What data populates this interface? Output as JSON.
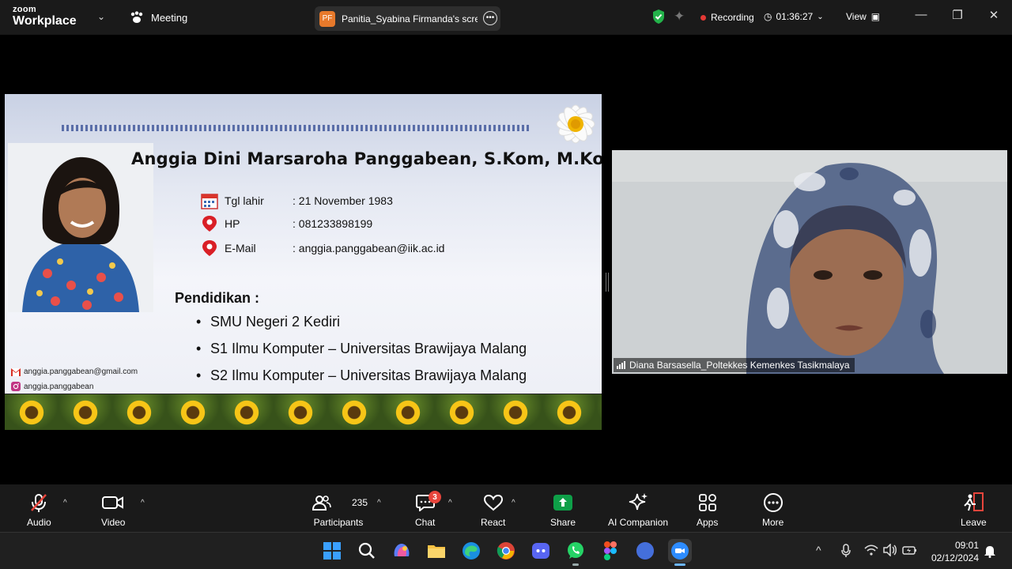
{
  "app": {
    "brand_line1": "zoom",
    "brand_line2": "Workplace",
    "meeting_label": "Meeting"
  },
  "share": {
    "initials": "PF",
    "title": "Panitia_Syabina Firmanda's screen"
  },
  "status": {
    "recording_label": "Recording",
    "timer": "01:36:27",
    "view_label": "View"
  },
  "slide": {
    "name": "Anggia Dini Marsaroha Panggabean, S.Kom, M.Kom.",
    "info": [
      {
        "label": "Tgl lahir",
        "value": ": 21 November 1983"
      },
      {
        "label": "HP",
        "value": ": 081233898199"
      },
      {
        "label": "E-Mail",
        "value": ": anggia.panggabean@iik.ac.id"
      }
    ],
    "education_title": "Pendidikan :",
    "education": [
      "SMU Negeri 2 Kediri",
      "S1 Ilmu Komputer – Universitas Brawijaya Malang",
      "S2 Ilmu Komputer – Universitas Brawijaya Malang"
    ],
    "contact_email": "anggia.panggabean@gmail.com",
    "contact_instagram": "anggia.panggabean"
  },
  "video": {
    "participant_name": "Diana Barsasella_Poltekkes Kemenkes Tasikmalaya"
  },
  "toolbar": {
    "audio": "Audio",
    "video": "Video",
    "participants": "Participants",
    "participants_count": "235",
    "chat": "Chat",
    "chat_badge": "3",
    "react": "React",
    "share": "Share",
    "ai_companion": "AI Companion",
    "apps": "Apps",
    "more": "More",
    "leave": "Leave"
  },
  "taskbar": {
    "time": "09:01",
    "date": "02/12/2024"
  },
  "colors": {
    "recording": "#e53935",
    "share_green": "#0e9f48",
    "leave_red": "#e8453c",
    "chat_badge": "#e8453c"
  }
}
